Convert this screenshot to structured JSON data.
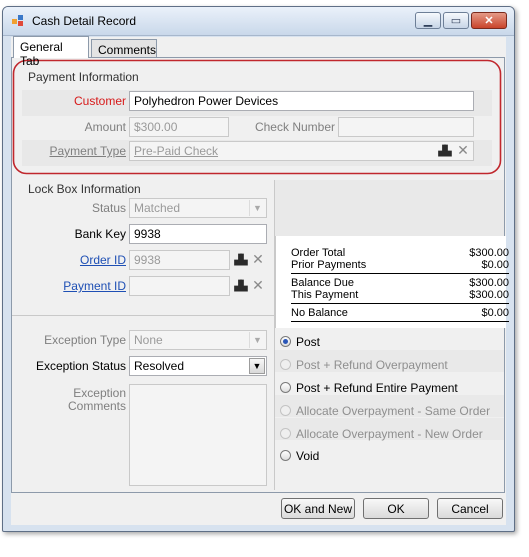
{
  "window": {
    "title": "Cash Detail  Record",
    "icon": "app-grid-icon"
  },
  "tabs": [
    {
      "label": "General Tab",
      "active": true
    },
    {
      "label": "Comments",
      "active": false
    }
  ],
  "payment_info": {
    "group_title": "Payment Information",
    "customer_label": "Customer",
    "customer_value": "Polyhedron Power Devices",
    "amount_label": "Amount",
    "amount_value": "$300.00",
    "check_number_label": "Check Number",
    "check_number_value": "",
    "payment_type_label": "Payment Type",
    "payment_type_value": "Pre-Paid Check"
  },
  "lock_box": {
    "group_title": "Lock Box Information",
    "status_label": "Status",
    "status_value": "Matched",
    "bank_key_label": "Bank Key",
    "bank_key_value": "9938",
    "order_id_label": "Order ID",
    "order_id_value": "9938",
    "payment_id_label": "Payment ID",
    "payment_id_value": ""
  },
  "summary": {
    "order_total_label": "Order Total",
    "order_total_value": "$300.00",
    "prior_payments_label": "Prior Payments",
    "prior_payments_value": "$0.00",
    "balance_due_label": "Balance Due",
    "balance_due_value": "$300.00",
    "this_payment_label": "This Payment",
    "this_payment_value": "$300.00",
    "no_balance_label": "No Balance",
    "no_balance_value": "$0.00"
  },
  "exception": {
    "type_label": "Exception Type",
    "type_value": "None",
    "status_label": "Exception Status",
    "status_value": "Resolved",
    "comments_label": "Exception Comments",
    "comments_value": ""
  },
  "actions": [
    {
      "label": "Post",
      "checked": true,
      "enabled": true
    },
    {
      "label": "Post + Refund Overpayment",
      "checked": false,
      "enabled": false
    },
    {
      "label": "Post + Refund Entire Payment",
      "checked": false,
      "enabled": true
    },
    {
      "label": "Allocate Overpayment - Same Order",
      "checked": false,
      "enabled": false
    },
    {
      "label": "Allocate Overpayment - New Order",
      "checked": false,
      "enabled": false
    },
    {
      "label": "Void",
      "checked": false,
      "enabled": true
    }
  ],
  "buttons": {
    "ok_and_new": "OK and New",
    "ok": "OK",
    "cancel": "Cancel"
  },
  "colors": {
    "required_label": "#d71a1a",
    "link_label": "#1e4fb4",
    "highlight_ring": "#c0272d"
  }
}
